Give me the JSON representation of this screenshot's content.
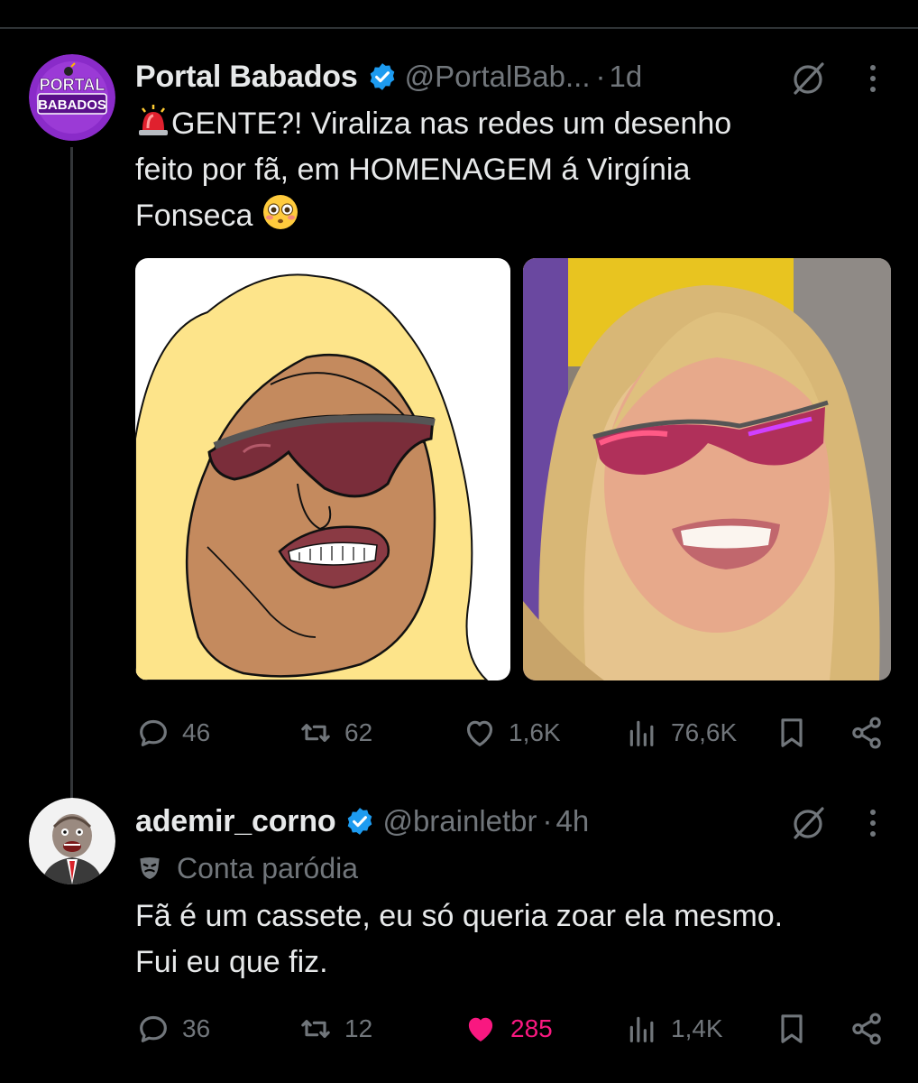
{
  "tweets": [
    {
      "author": {
        "name": "Portal Babados",
        "handle": "@PortalBab...",
        "avatar_text_top": "PORTAL",
        "avatar_text_bottom": "BABADOS"
      },
      "time_separator": "·",
      "time": "1d",
      "text": {
        "emoji_start": "siren-emoji",
        "line1": "GENTE?! Viraliza nas redes um desenho",
        "line2": "feito por fã, em HOMENAGEM á Virgínia",
        "line3": "Fonseca",
        "emoji_end": "flushed-face-emoji"
      },
      "media": [
        "drawing-caricature",
        "photo-woman-sunglasses"
      ],
      "stats": {
        "replies": "46",
        "reposts": "62",
        "likes": "1,6K",
        "views": "76,6K"
      },
      "liked": false
    },
    {
      "author": {
        "name": "ademir_corno",
        "handle": "@brainletbr"
      },
      "time_separator": "·",
      "time": "4h",
      "label": "Conta paródia",
      "text": {
        "line1": "Fã é um cassete, eu só queria zoar ela mesmo.",
        "line2": "Fui eu que fiz."
      },
      "stats": {
        "replies": "36",
        "reposts": "12",
        "likes": "285",
        "views": "1,4K"
      },
      "liked": true
    }
  ],
  "colors": {
    "background": "#000000",
    "text_primary": "#e7e9ea",
    "text_secondary": "#71767b",
    "verified_blue": "#1d9bf0",
    "like_pink": "#f91880",
    "avatar_purple": "#8a2bc9"
  },
  "icons": [
    "verified-badge-icon",
    "grok-icon",
    "more-icon",
    "reply-icon",
    "repost-icon",
    "like-icon",
    "views-icon",
    "bookmark-icon",
    "share-icon",
    "parody-mask-icon"
  ]
}
